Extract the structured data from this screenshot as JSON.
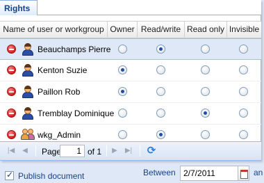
{
  "tab": {
    "label": "Rights"
  },
  "grid": {
    "columns": [
      "Name of user or workgroup",
      "Owner",
      "Read/write",
      "Read only",
      "Invisible"
    ],
    "rows": [
      {
        "name": "Beauchamps Pierre",
        "type": "user",
        "selected_right": "Read/write",
        "row_selected": true
      },
      {
        "name": "Kenton Suzie",
        "type": "user",
        "selected_right": "Owner",
        "row_selected": false
      },
      {
        "name": "Paillon Rob",
        "type": "user",
        "selected_right": "Owner",
        "row_selected": false
      },
      {
        "name": "Tremblay Dominique",
        "type": "user",
        "selected_right": "Read only",
        "row_selected": false
      },
      {
        "name": "wkg_Admin",
        "type": "workgroup",
        "selected_right": "Read/write",
        "row_selected": false
      }
    ]
  },
  "pager": {
    "page_label": "Page",
    "page_value": "1",
    "of_label": "of 1"
  },
  "publish": {
    "label": "Publish document",
    "checked": true
  },
  "date_filter": {
    "between_label": "Between",
    "start_date": "2/7/2011",
    "and_label": "an"
  }
}
